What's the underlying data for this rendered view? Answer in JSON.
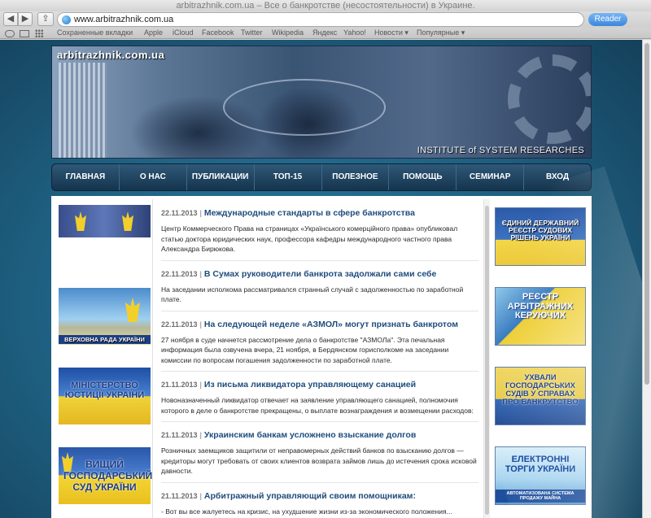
{
  "browser": {
    "window_title": "arbitrazhnik.com.ua – Все о банкротстве (несостоятельности) в Украине.",
    "url": "www.arbitrazhnik.com.ua",
    "reader_label": "Reader",
    "bookmarks": [
      "Сохраненные вкладки",
      "Apple",
      "iCloud",
      "Facebook",
      "Twitter",
      "Wikipedia",
      "Яндекс",
      "Yahoo!",
      "Новости ▾",
      "Популярные ▾"
    ]
  },
  "banner": {
    "site_name": "arbitrazhnik.com.ua",
    "institute": "INSTITUTE of SYSTEM RESEARCHES"
  },
  "nav": [
    "ГЛАВНАЯ",
    "О НАС",
    "ПУБЛИКАЦИИ",
    "ТОП-15",
    "ПОЛЕЗНОЕ",
    "ПОМОЩЬ",
    "СЕМИНАР",
    "ВХОД"
  ],
  "left_banners": {
    "rada": "ВЕРХОВНА РАДА УКРАЇНИ",
    "ministry": "МІНІСТЕРСТВО ЮСТИЦІЇ УКРАЇНИ",
    "court": "ВИЩИЙ ГОСПОДАРСЬКИЙ СУД УКРАЇНИ"
  },
  "news": [
    {
      "date": "22.11.2013",
      "title": "Международные стандарты в сфере банкротства",
      "text": "Центр Коммерческого Права на страницах «Українського комерційного права» опубликовал статью доктора юридических наук, профессора кафедры международного частного права Александра Бирюкова."
    },
    {
      "date": "22.11.2013",
      "title": "В Сумах руководители банкрота задолжали сами себе",
      "text": "На заседании исполкома рассматривался странный случай с задолженностью по заработной плате."
    },
    {
      "date": "22.11.2013",
      "title": "На следующей неделе «АЗМОЛ» могут признать банкротом",
      "text": "27 ноября в суде начнется рассмотрение дела о банкротстве \"АЗМОЛа\". Эта печальная информация была озвучена вчера, 21 ноября, в Бердянском горисполкоме на заседании комиссии по вопросам погашения задолженности по заработной плате."
    },
    {
      "date": "21.11.2013",
      "title": "Из письма ликвидатора управляющему санацией",
      "text": "Новоназначенный ликвидатор отвечает на заявление управляющего санацией, полномочия которого в деле о банкротстве прекращены, о выплате вознаграждения и возмещении расходов:"
    },
    {
      "date": "21.11.2013",
      "title": "Украинским банкам усложнено взыскание долгов",
      "text": "Розничных заемщиков защитили от неправомерных действий банков по взысканию долгов — кредиторы могут требовать от своих клиентов возврата займов лишь до истечения срока исковой давности."
    },
    {
      "date": "21.11.2013",
      "title": "Арбитражный управляющий своим помощникам:",
      "text": "- Вот вы все жалуетесь на кризис, на ухудшение жизни из-за экономического положения..."
    }
  ],
  "right_banners": {
    "registry": "ЄДИНИЙ ДЕРЖАВНИЙ РЕЄСТР СУДОВИХ РІШЕНЬ УКРАЇНИ",
    "managers": "РЕЄСТР АРБІТРАЖНИХ КЕРУЮЧИХ",
    "rulings": "УХВАЛИ ГОСПОДАРСЬКИХ СУДІВ У СПРАВАХ ПРО БАНКРУТСТВО",
    "auctions": "ЕЛЕКТРОННІ ТОРГИ УКРАЇНИ",
    "auctions_sub": "АВТОМАТИЗОВАНА СИСТЕМА ПРОДАЖУ МАЙНА"
  },
  "colors": {
    "nav_bg": "#1f4565",
    "news_title": "#1e4c7c",
    "page_bg": "#1e5f80"
  }
}
